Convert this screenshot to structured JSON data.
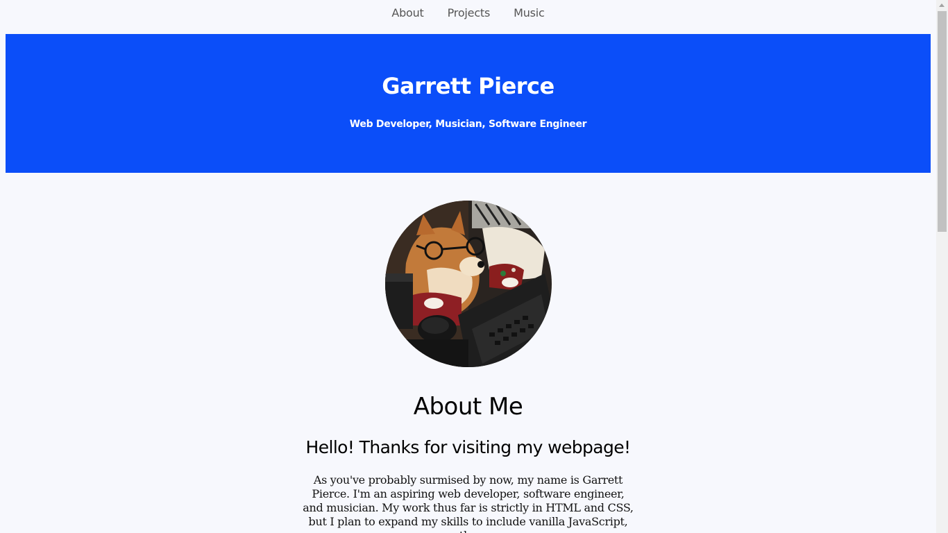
{
  "nav": {
    "items": [
      "About",
      "Projects",
      "Music"
    ]
  },
  "hero": {
    "title": "Garrett Pierce",
    "subtitle": "Web Developer, Musician, Software Engineer",
    "background_color": "#0b4ef9"
  },
  "about": {
    "heading": "About Me",
    "subheading": "Hello! Thanks for visiting my webpage!",
    "body": "As you've probably surmised by now, my name is Garrett Pierce. I'm an aspiring web developer, software engineer, and musician. My work thus far is strictly in HTML and CSS, but I plan to expand my skills to include vanilla JavaScript, the"
  },
  "colors": {
    "page_background": "#f7f8fd",
    "accent": "#0b4ef9"
  }
}
